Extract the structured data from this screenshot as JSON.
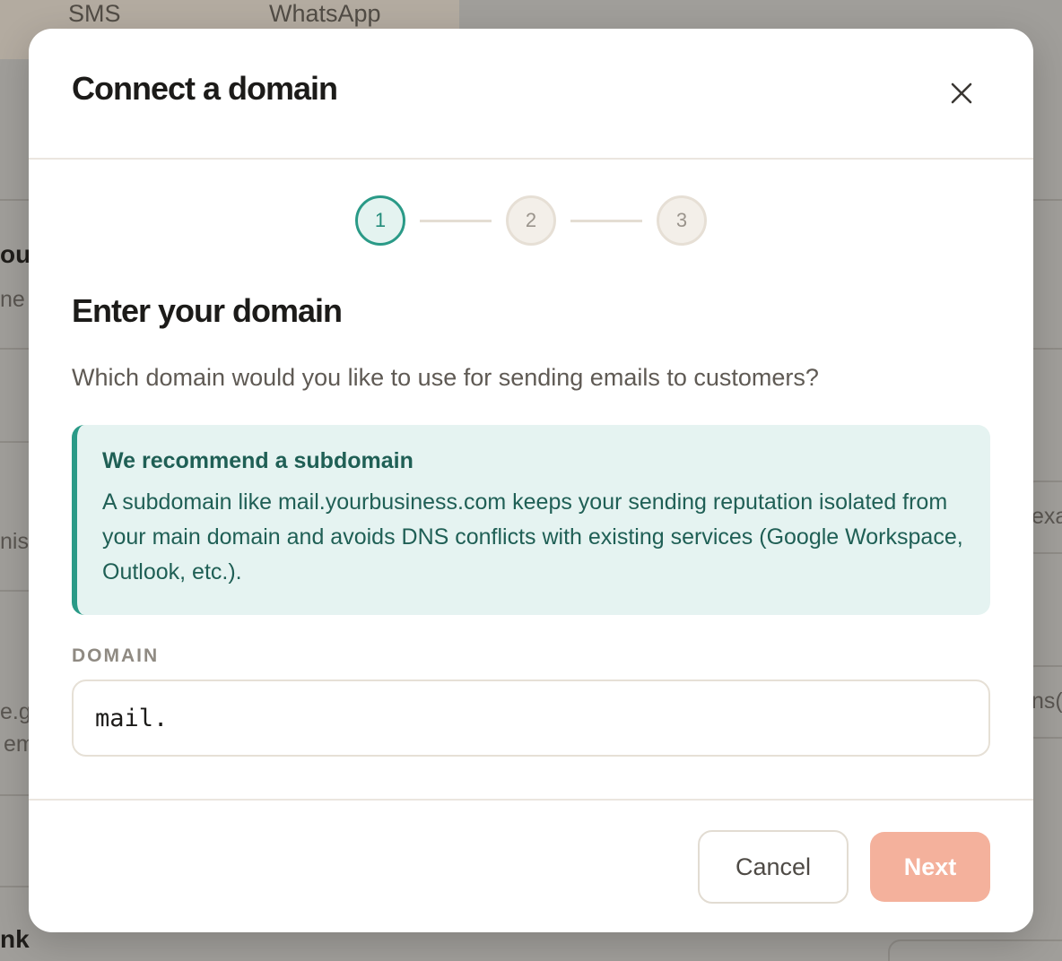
{
  "background": {
    "tabs": [
      "SMS",
      "WhatsApp"
    ],
    "fragments": [
      "ou",
      "ne",
      "nis",
      "e.g",
      "em",
      "nk",
      "exa",
      "ns("
    ]
  },
  "modal": {
    "title": "Connect a domain",
    "close_icon": "close-icon",
    "steps": [
      "1",
      "2",
      "3"
    ],
    "active_step": 1,
    "section_title": "Enter your domain",
    "section_description": "Which domain would you like to use for sending emails to customers?",
    "callout": {
      "title": "We recommend a subdomain",
      "body": "A subdomain like mail.yourbusiness.com keeps your sending reputation isolated from your main domain and avoids DNS conflicts with existing services (Google Workspace, Outlook, etc.)."
    },
    "domain_field": {
      "label": "DOMAIN",
      "value": "mail."
    },
    "buttons": {
      "cancel": "Cancel",
      "next": "Next"
    }
  },
  "colors": {
    "accent_teal": "#2a9a87",
    "callout_bg": "#e5f3f1",
    "next_button": "#f4b19c",
    "overlay": "#a09e9a"
  }
}
